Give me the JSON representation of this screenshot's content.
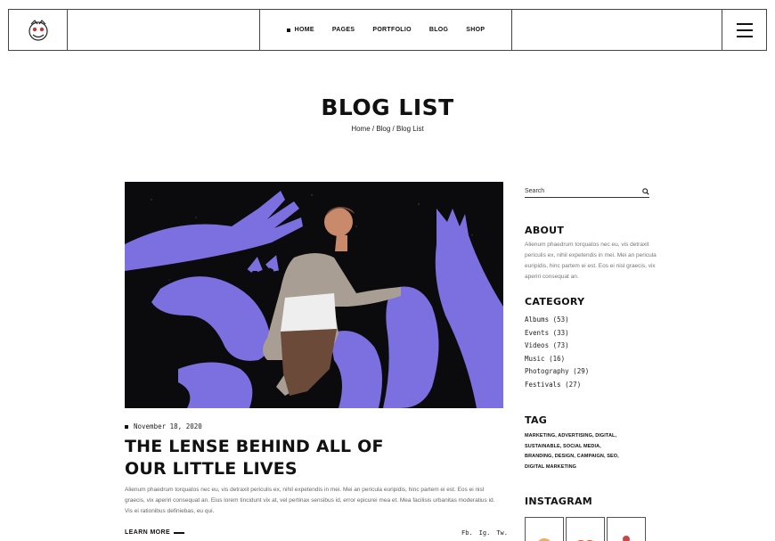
{
  "header": {
    "nav": [
      {
        "label": "HOME",
        "active": true
      },
      {
        "label": "PAGES",
        "active": false
      },
      {
        "label": "PORTFOLIO",
        "active": false
      },
      {
        "label": "BLOG",
        "active": false
      },
      {
        "label": "SHOP",
        "active": false
      }
    ]
  },
  "page": {
    "title": "BLOG LIST",
    "breadcrumb": "Home / Blog / Blog List"
  },
  "post": {
    "date": "November 18, 2020",
    "title_line1": "THE LENSE BEHIND ALL OF",
    "title_line2": "OUR LITTLE LIVES",
    "excerpt": "Alienum phaedrum torquatos nec eu, vis detraxit periculis ex, nihil expetendis in mei. Mei an pericula euripidis, hinc partem ei est. Eos ei nisl graecis, vix aperiri consequat an. Eius lorem tincidunt vix at, vel pertinax sensibus id, error epicurei mea et. Mea facilisis urbanitas moderatius id. Vis ei rationibus definiebas, eu qui.",
    "read_more": "LEARN MORE",
    "share": [
      "Fb.",
      "Ig.",
      "Tw."
    ]
  },
  "sidebar": {
    "search_placeholder": "Search",
    "about_heading": "ABOUT",
    "about_text": "Alienum phaedrum torquatos nec eu, vis detraxit periculis ex, nihil expetendis in mei. Mei an pericula euripidis, hinc partem ei est. Eos ei nisl graecis, vix aperiri consequat an.",
    "category_heading": "CATEGORY",
    "categories": [
      "Albums (53)",
      "Events (33)",
      "Videos (73)",
      "Music (16)",
      "Photography (29)",
      "Festivals (27)"
    ],
    "tag_heading": "TAG",
    "tags": "MARKETING, ADVERTISING, DIGITAL, SUSTAINABLE, SOCIAL MEDIA, BRANDING, DESIGN, CAMPAIGN, SEO, DIGITAL MARKETING",
    "instagram_heading": "INSTAGRAM"
  },
  "colors": {
    "accent": "#7c6fe0",
    "hero_bg": "#0b0b0d"
  }
}
